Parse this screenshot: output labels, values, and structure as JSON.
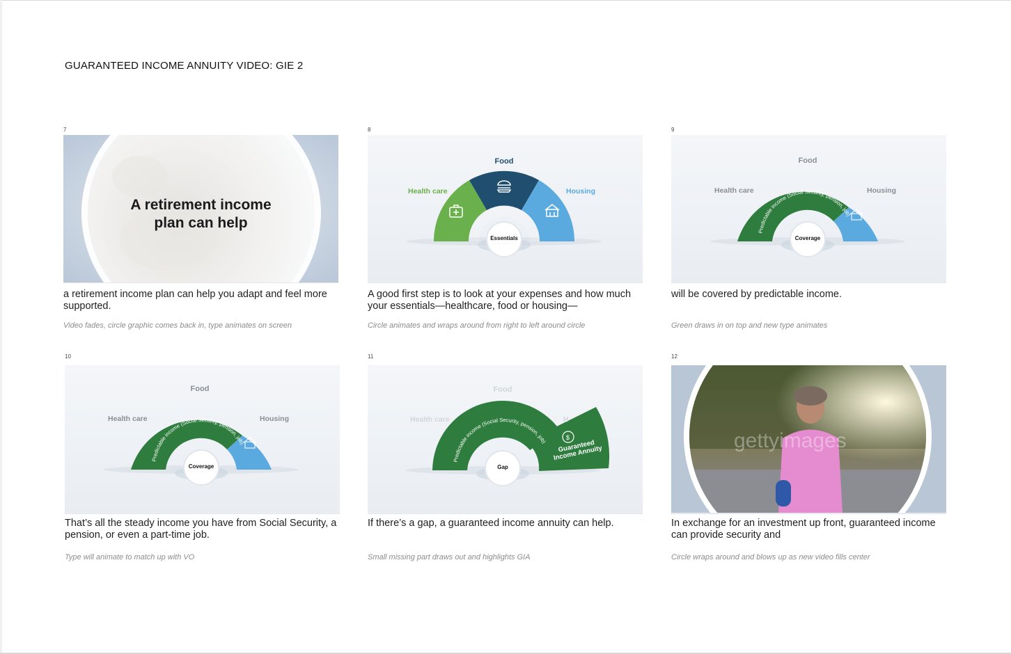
{
  "document": {
    "title": "GUARANTEED INCOME ANNUITY VIDEO: GIE 2"
  },
  "colors": {
    "healthcare_green": "#6ab04c",
    "food_navy": "#1f4e6e",
    "housing_blue": "#5aa9df",
    "coverage_green": "#2e7d3e",
    "label_gray": "#8a8f96"
  },
  "frames": [
    {
      "number": "7",
      "headline_line1": "A retirement income",
      "headline_line2": "plan can help",
      "caption": "a retirement income plan can help you adapt and feel more supported.",
      "note": "Video fades, circle graphic comes back in, type animates on screen"
    },
    {
      "number": "8",
      "label_food": "Food",
      "label_health": "Health care",
      "label_housing": "Housing",
      "center_label": "Essentials",
      "caption": "A good first step is to look at your expenses and how much your essentials—healthcare, food or housing—",
      "note": "Circle animates and wraps around from right to left around circle"
    },
    {
      "number": "9",
      "label_food": "Food",
      "label_health": "Health care",
      "label_housing": "Housing",
      "arc_text": "Predictable income (Social Security, pension, job)",
      "center_label": "Coverage",
      "caption": "will be covered by predictable income.",
      "note": "Green draws in on top and new type animates"
    },
    {
      "number": "10",
      "label_food": "Food",
      "label_health": "Health care",
      "label_housing": "Housing",
      "arc_text": "Predictable income (Social Security, pension, job)",
      "center_label": "Coverage",
      "caption": "That’s all the steady income you have from Social Security, a pension, or even a part-time job.",
      "note": "Type will animate to match up with VO"
    },
    {
      "number": "11",
      "label_food": "Food",
      "label_health": "Health care",
      "label_housing": "H",
      "arc_text": "Predictable income (Social Security, pension, job)",
      "gia_line1": "Guaranteed",
      "gia_line2": "Income Annuity",
      "center_label": "Gap",
      "caption": "If there’s a gap, a guaranteed income annuity can help.",
      "note": "Small missing part draws out and highlights GIA"
    },
    {
      "number": "12",
      "watermark": "gettyimages",
      "caption": "In exchange for an investment up front, guaranteed income can provide security and",
      "note": "Circle wraps around and blows up as new video fills center"
    }
  ]
}
